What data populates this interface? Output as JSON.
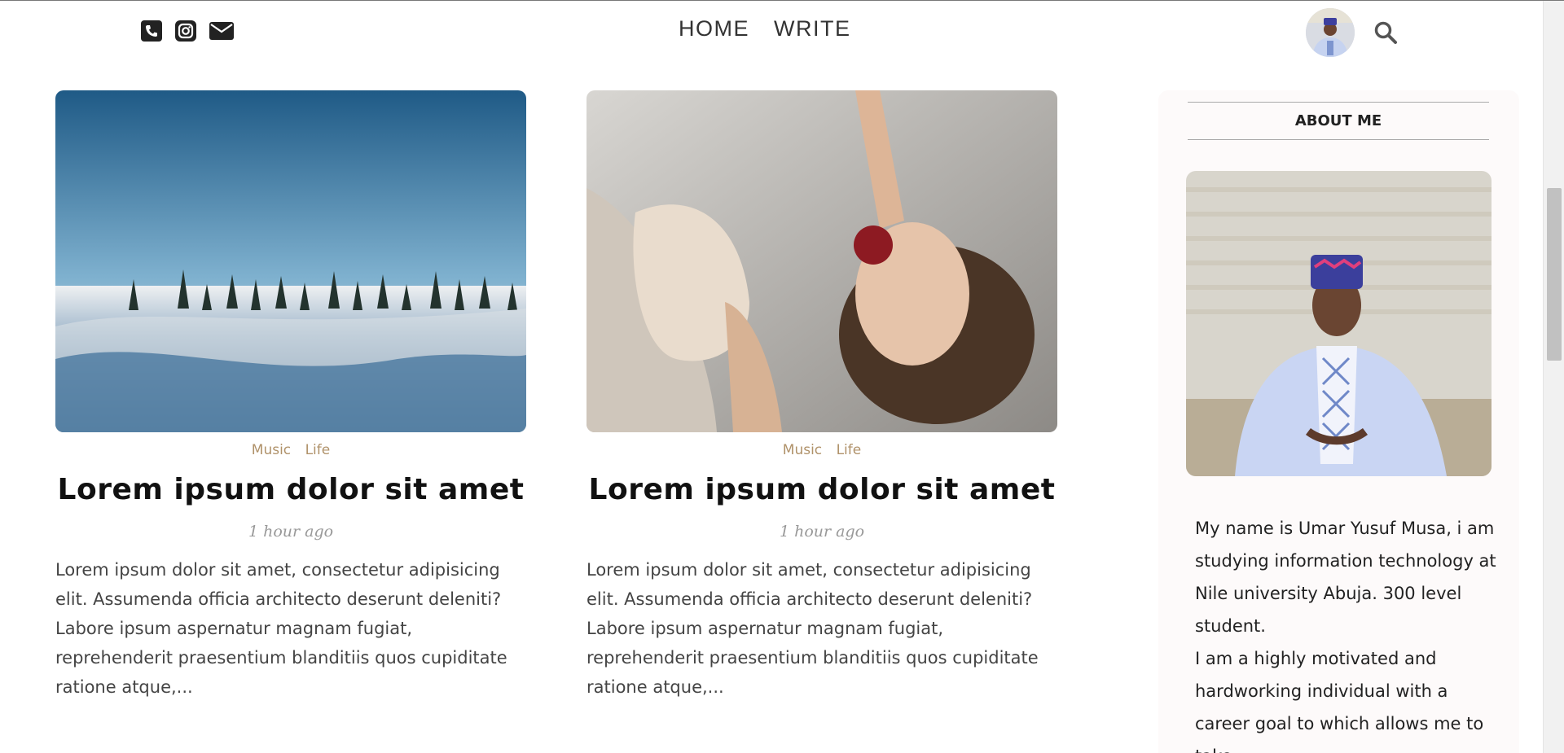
{
  "nav": {
    "home": "HOME",
    "write": "WRITE"
  },
  "icons": {
    "phone": "phone-icon",
    "instagram": "instagram-icon",
    "mail": "mail-icon",
    "search": "search-icon"
  },
  "posts": [
    {
      "categories": [
        "Music",
        "Life"
      ],
      "title": "Lorem ipsum dolor sit amet",
      "date": "1 hour ago",
      "excerpt": "Lorem ipsum dolor sit amet, consectetur adipisicing elit. Assumenda officia architecto deserunt deleniti? Labore ipsum aspernatur magnam fugiat, reprehenderit praesentium blanditiis quos cupiditate ratione atque,..."
    },
    {
      "categories": [
        "Music",
        "Life"
      ],
      "title": "Lorem ipsum dolor sit amet",
      "date": "1 hour ago",
      "excerpt": "Lorem ipsum dolor sit amet, consectetur adipisicing elit. Assumenda officia architecto deserunt deleniti? Labore ipsum aspernatur magnam fugiat, reprehenderit praesentium blanditiis quos cupiditate ratione atque,..."
    }
  ],
  "sidebar": {
    "title": "ABOUT ME",
    "bio_1": "My name is Umar Yusuf Musa, i am studying information technology at Nile university Abuja. 300 level student.",
    "bio_2": "I am a highly motivated and hardworking individual with a career goal to which allows me to take"
  },
  "colors": {
    "category": "#b0926a",
    "sidebar_bg": "#fdfafa",
    "text": "#444444"
  }
}
